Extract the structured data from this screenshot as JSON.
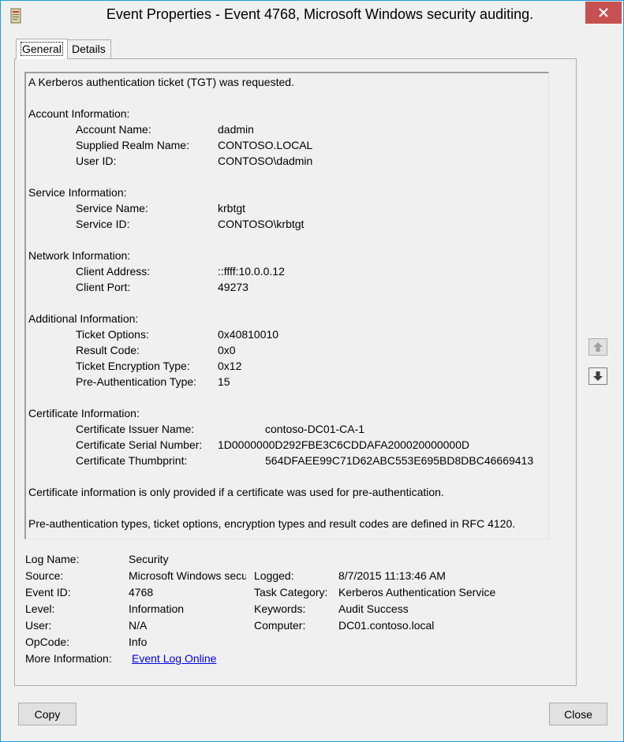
{
  "window": {
    "title": "Event Properties - Event 4768, Microsoft Windows security auditing.",
    "accent_color": "#1a9bd8",
    "close_color": "#c75050"
  },
  "tabs": [
    {
      "label": "General",
      "active": true
    },
    {
      "label": "Details",
      "active": false
    }
  ],
  "description": {
    "summary": "A Kerberos authentication ticket (TGT) was requested.",
    "sections": [
      {
        "heading": "Account Information:",
        "rows": [
          {
            "key": "Account Name:",
            "value": "dadmin"
          },
          {
            "key": "Supplied Realm Name:",
            "value": "CONTOSO.LOCAL"
          },
          {
            "key": "User ID:",
            "value": "CONTOSO\\dadmin"
          }
        ]
      },
      {
        "heading": "Service Information:",
        "rows": [
          {
            "key": "Service Name:",
            "value": "krbtgt"
          },
          {
            "key": "Service ID:",
            "value": "CONTOSO\\krbtgt"
          }
        ]
      },
      {
        "heading": "Network Information:",
        "rows": [
          {
            "key": "Client Address:",
            "value": "::ffff:10.0.0.12"
          },
          {
            "key": "Client Port:",
            "value": "49273"
          }
        ]
      },
      {
        "heading": "Additional Information:",
        "rows": [
          {
            "key": "Ticket Options:",
            "value": "0x40810010"
          },
          {
            "key": "Result Code:",
            "value": "0x0"
          },
          {
            "key": "Ticket Encryption Type:",
            "value": "0x12"
          },
          {
            "key": "Pre-Authentication Type:",
            "value": "15"
          }
        ]
      },
      {
        "heading": "Certificate Information:",
        "rows": [
          {
            "key": "Certificate Issuer Name:",
            "value": "contoso-DC01-CA-1"
          },
          {
            "key": "Certificate Serial Number:",
            "value": "1D0000000D292FBE3C6CDDAFA200020000000D"
          },
          {
            "key": "Certificate Thumbprint:",
            "value": "564DFAEE99C71D62ABC553E695BD8DBC46669413"
          }
        ]
      }
    ],
    "note1": "Certificate information is only provided if a certificate was used for pre-authentication.",
    "note2": "Pre-authentication types, ticket options, encryption types and result codes are defined in RFC 4120."
  },
  "details": {
    "log_name_label": "Log Name:",
    "log_name": "Security",
    "source_label": "Source:",
    "source": "Microsoft Windows security auditing.",
    "logged_label": "Logged:",
    "logged": "8/7/2015 11:13:46 AM",
    "event_id_label": "Event ID:",
    "event_id": "4768",
    "task_category_label": "Task Category:",
    "task_category": "Kerberos Authentication Service",
    "level_label": "Level:",
    "level": "Information",
    "keywords_label": "Keywords:",
    "keywords": "Audit Success",
    "user_label": "User:",
    "user": "N/A",
    "computer_label": "Computer:",
    "computer": "DC01.contoso.local",
    "opcode_label": "OpCode:",
    "opcode": "Info",
    "more_info_label": "More Information:",
    "more_info_link": "Event Log Online"
  },
  "buttons": {
    "copy": "Copy",
    "close": "Close",
    "scroll_up_icon": "arrow-up-icon",
    "scroll_down_icon": "arrow-down-icon"
  }
}
